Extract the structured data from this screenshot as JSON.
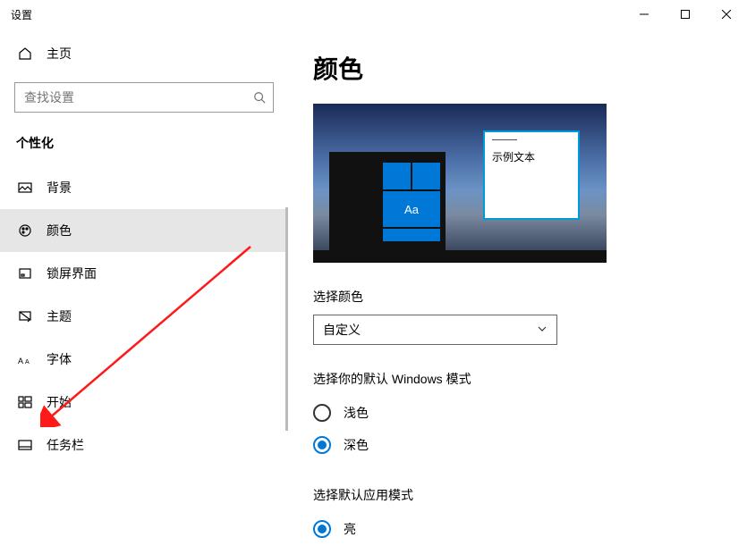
{
  "window": {
    "title": "设置"
  },
  "sidebar": {
    "home": "主页",
    "search_placeholder": "查找设置",
    "section": "个性化",
    "items": [
      {
        "label": "背景"
      },
      {
        "label": "颜色"
      },
      {
        "label": "锁屏界面"
      },
      {
        "label": "主题"
      },
      {
        "label": "字体"
      },
      {
        "label": "开始"
      },
      {
        "label": "任务栏"
      }
    ]
  },
  "main": {
    "title": "颜色",
    "preview_sample_text": "示例文本",
    "preview_tile_text": "Aa",
    "select_color_label": "选择颜色",
    "select_color_value": "自定义",
    "windows_mode_label": "选择你的默认 Windows 模式",
    "windows_mode_options": {
      "light": "浅色",
      "dark": "深色"
    },
    "app_mode_label": "选择默认应用模式",
    "app_mode_options": {
      "light": "亮"
    }
  }
}
